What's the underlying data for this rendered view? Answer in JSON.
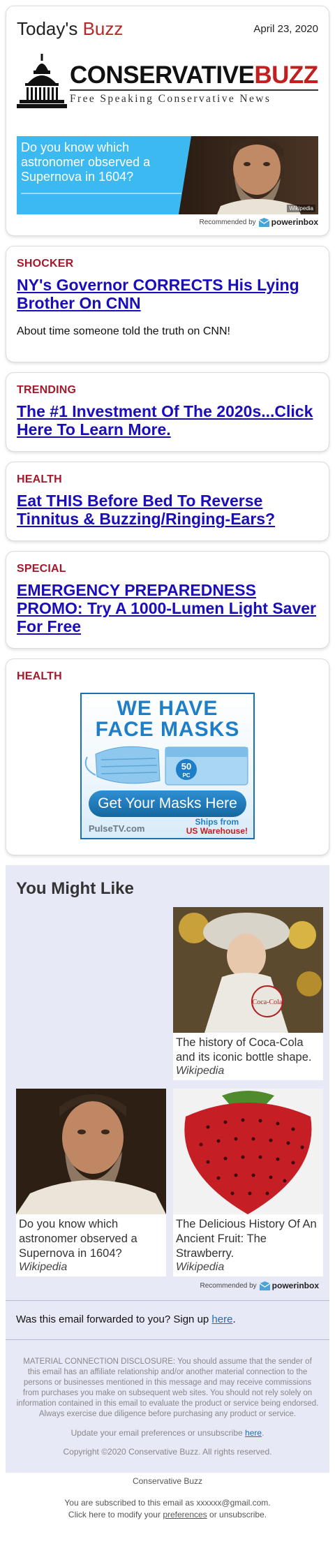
{
  "header": {
    "brand_first": "Today's",
    "brand_second": "Buzz",
    "date": "April 23, 2020"
  },
  "logo": {
    "main_black": "CONSERVATIVE",
    "main_red": "BUZZ",
    "tagline": "Free Speaking Conservative News"
  },
  "top_ad": {
    "text": "Do you know which astronomer observed a Supernova in 1604?",
    "image_caption": "Wikipedia",
    "recommended_by": "Recommended by",
    "provider": "powerinbox"
  },
  "stories": [
    {
      "kicker": "SHOCKER",
      "headline": "NY's Governor CORRECTS His Lying Brother On CNN",
      "dek": "About time someone told the truth on CNN!"
    },
    {
      "kicker": "TRENDING",
      "headline": "The #1 Investment Of The 2020s...Click Here To Learn More."
    },
    {
      "kicker": "HEALTH",
      "headline": "Eat THIS Before Bed To Reverse Tinnitus & Buzzing/Ringing-Ears?"
    },
    {
      "kicker": "SPECIAL",
      "headline": "EMERGENCY PREPAREDNESS PROMO: Try A 1000-Lumen Light Saver For Free"
    }
  ],
  "mask_ad": {
    "kicker": "HEALTH",
    "line1": "WE HAVE",
    "line2": "FACE MASKS",
    "count_num": "50",
    "count_unit": "PC",
    "button": "Get Your Masks Here",
    "source": "PulseTV.com",
    "ship_1": "Ships from",
    "ship_2": "US Warehouse!"
  },
  "you_might_like": {
    "title": "You Might Like",
    "tiles": [
      {
        "title": "The history of Coca-Cola and its iconic bottle shape.",
        "source": "Wikipedia"
      },
      {
        "title": "Do you know which astronomer observed a Supernova in 1604?",
        "source": "Wikipedia"
      },
      {
        "title": "The Delicious History Of An Ancient Fruit: The Strawberry.",
        "source": "Wikipedia"
      }
    ],
    "recommended_by": "Recommended by",
    "provider": "powerinbox"
  },
  "forward": {
    "text": "Was this email forwarded to you? Sign up",
    "link": "here",
    "end": "."
  },
  "fine_print": {
    "disclosure": "MATERIAL CONNECTION DISCLOSURE: You should assume that the sender of this email has an affiliate relationship and/or another material connection to the persons or businesses mentioned in this message and may receive commissions from purchases you make on subsequent web sites. You should not rely solely on information contained in this email to evaluate the product or service being endorsed. Always exercise due diligence before purchasing any product or service.",
    "update_text": "Update your email preferences or unsubscribe",
    "update_link": "here",
    "update_end": ".",
    "copyright": "Copyright ©2020 Conservative Buzz. All rights reserved."
  },
  "footer": {
    "company": "Conservative Buzz",
    "subscribed": "You are subscribed to this email as xxxxxx@gmail.com.",
    "modify_pre": "Click here to modify your",
    "modify_link": "preferences",
    "modify_post": "or unsubscribe."
  },
  "colors": {
    "accent_red": "#a3192b",
    "link_blue": "#1a0dbb",
    "panel_bg": "#e8e9f7",
    "ad_blue": "#3cb9f1"
  }
}
